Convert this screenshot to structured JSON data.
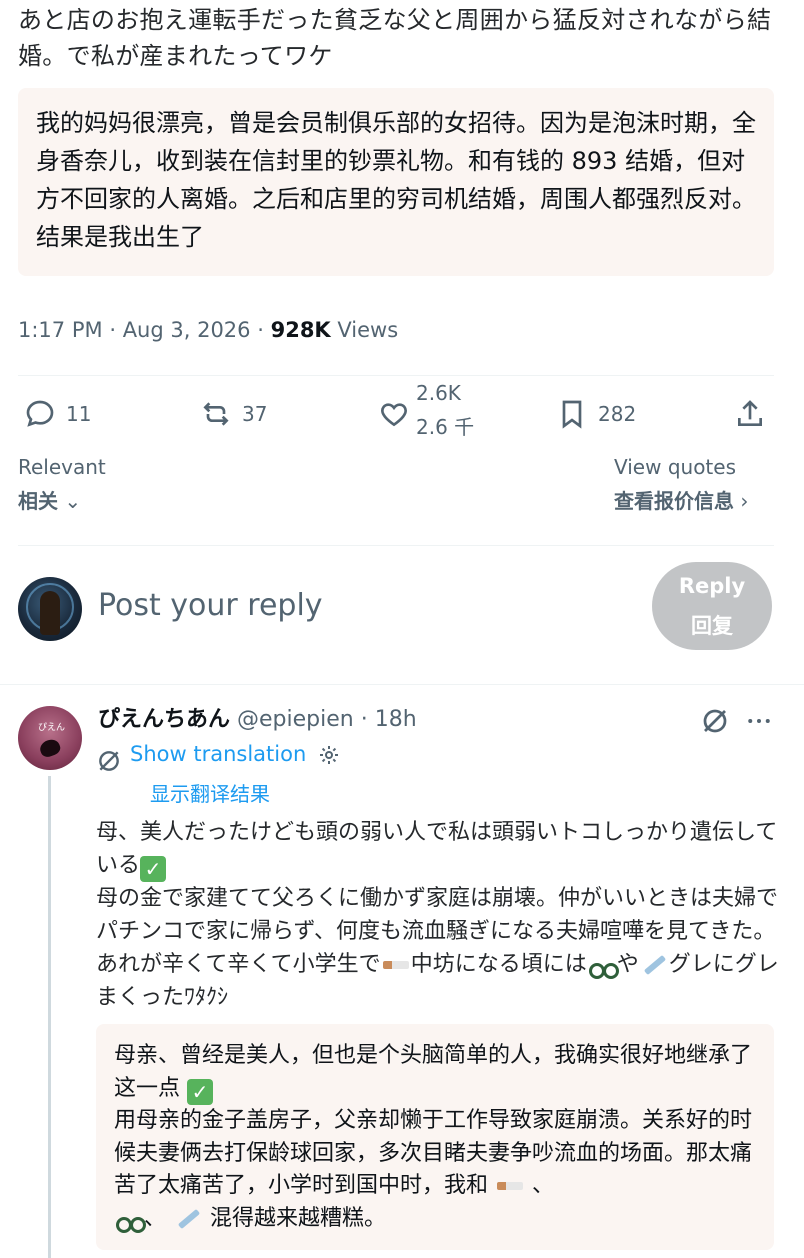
{
  "tweet": {
    "original_text": "あと店のお抱え運転手だった貧乏な父と周囲から猛反対されながら結婚。で私が産まれたってワケ",
    "translation": "我的妈妈很漂亮，曾是会员制俱乐部的女招待。因为是泡沫时期，全身香奈儿，收到装在信封里的钞票礼物。和有钱的 893 结婚，但对方不回家的人离婚。之后和店里的穷司机结婚，周围人都强烈反对。结果是我出生了",
    "time": "1:17 PM",
    "date": "Aug 3, 2026",
    "separator": "·",
    "views_count": "928K",
    "views_label": "Views"
  },
  "actions": {
    "replies": "11",
    "retweets": "37",
    "likes": "2.6K",
    "likes_zh": "2.6 千",
    "bookmarks": "282"
  },
  "sort": {
    "relevant": "Relevant",
    "relevant_zh": "相关",
    "view_quotes": "View quotes",
    "view_quotes_zh": "查看报价信息"
  },
  "composer": {
    "placeholder": "Post your reply",
    "reply_button": "Reply",
    "reply_button_zh": "回复"
  },
  "reply": {
    "display_name": "ぴえんちあん",
    "handle": "@epiepien",
    "age": "18h",
    "show_translation": "Show translation",
    "show_translation_zh": "显示翻译结果",
    "avatar_caption": "ぴえん",
    "text_line1": "母、美人だったけども頭の弱い人で私は頭弱いトコしっかり遺伝している",
    "text_line2a": "母の金で家建てて父ろくに働かず家庭は崩壊。仲がいいときは夫婦でパチンコで家に帰らず、何度も流血騒ぎになる夫婦喧嘩を見てきた。あれが辛くて辛くて小学生で",
    "text_line2b": "中坊になる頃には",
    "text_line2c": "や",
    "text_line2d": "グレにグレまくったﾜﾀｸｼ",
    "translation_line1": "母亲、曾经是美人，但也是个头脑简单的人，我确实很好地继承了这一点",
    "translation_line2a": "用母亲的金子盖房子，父亲却懒于工作导致家庭崩溃。关系好的时候夫妻俩去打保龄球回家，多次目睹夫妻争吵流血的场面。那太痛苦了太痛苦了，小学时到国中时，我和",
    "translation_line2b": "、",
    "translation_line2c": "、",
    "translation_line2d": "混得越来越糟糕。"
  },
  "colors": {
    "link": "#1d9bf0",
    "muted": "#536471",
    "translation_bg": "#fbf5f2",
    "reply_button_bg": "#c2c4c6"
  }
}
